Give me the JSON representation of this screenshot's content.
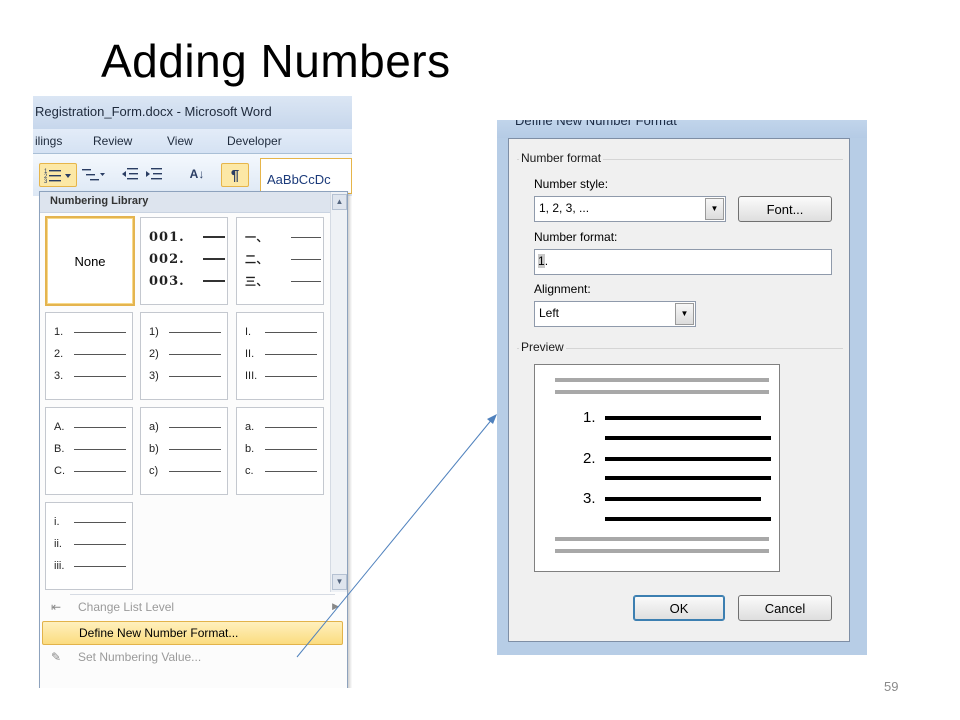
{
  "slide": {
    "title": "Adding Numbers",
    "page_number": "59"
  },
  "word": {
    "window_title": "Registration_Form.docx - Microsoft Word",
    "ribbon_tabs": [
      "ilings",
      "Review",
      "View",
      "Developer"
    ],
    "style_gallery_sample": "AaBbCcDc",
    "paragraph_mark": "¶",
    "sort_label": "A↓",
    "numbering_menu": {
      "header": "Numbering Library",
      "none_label": "None",
      "tiles": {
        "t2": [
          "001.",
          "002.",
          "003."
        ],
        "t3": [
          "一、",
          "二、",
          "三、"
        ],
        "t4": [
          "1.",
          "2.",
          "3."
        ],
        "t5": [
          "1)",
          "2)",
          "3)"
        ],
        "t6": [
          "I.",
          "II.",
          "III."
        ],
        "t7": [
          "A.",
          "B.",
          "C."
        ],
        "t8": [
          "a)",
          "b)",
          "c)"
        ],
        "t9": [
          "a.",
          "b.",
          "c."
        ],
        "t10": [
          "i.",
          "ii.",
          "iii."
        ]
      },
      "items": {
        "change_list_level": "Change List Level",
        "define_new_number_format": "Define New Number Format...",
        "set_numbering_value": "Set Numbering Value..."
      }
    }
  },
  "dialog": {
    "title": "Define New Number Format",
    "group_number_format": "Number format",
    "number_style_label": "Number style:",
    "number_style_value": "1, 2, 3, ...",
    "font_button": "Font...",
    "number_format_label": "Number format:",
    "number_format_value": "1",
    "number_format_suffix": ".",
    "alignment_label": "Alignment:",
    "alignment_value": "Left",
    "group_preview": "Preview",
    "preview_numbers": [
      "1.",
      "2.",
      "3."
    ],
    "ok_button": "OK",
    "cancel_button": "Cancel"
  },
  "colors": {
    "highlight": "#fbdc80",
    "arrow": "#4f81bd"
  }
}
